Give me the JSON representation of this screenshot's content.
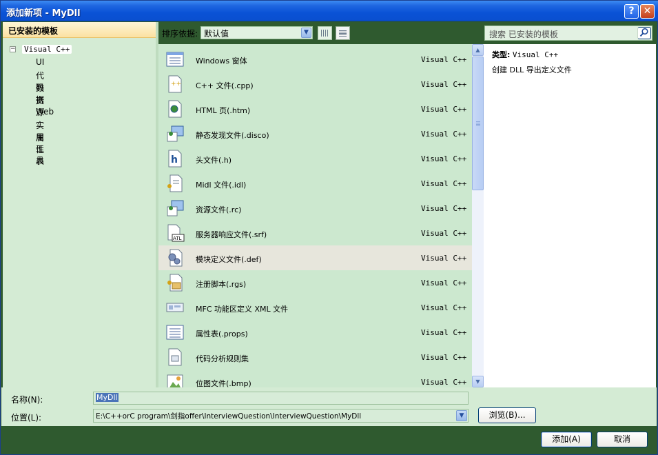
{
  "window": {
    "title": "添加新项 - MyDll",
    "help_label": "?",
    "close_label": "✕"
  },
  "sidebar": {
    "header": "已安装的模板",
    "tree": {
      "root": "Visual C++",
      "toggle": "−",
      "children": [
        "UI",
        "代码",
        "数据",
        "资源",
        "Web",
        "实用工具",
        "属性表"
      ]
    }
  },
  "toolbar": {
    "sort_label": "排序依据:",
    "sort_value": "默认值",
    "search_placeholder": "搜索 已安装的模板"
  },
  "templates": [
    {
      "name": "Windows 窗体",
      "type": "Visual C++",
      "icon": "form-icon"
    },
    {
      "name": "C++ 文件(.cpp)",
      "type": "Visual C++",
      "icon": "cpp-file-icon"
    },
    {
      "name": "HTML 页(.htm)",
      "type": "Visual C++",
      "icon": "html-file-icon"
    },
    {
      "name": "静态发现文件(.disco)",
      "type": "Visual C++",
      "icon": "disco-file-icon"
    },
    {
      "name": "头文件(.h)",
      "type": "Visual C++",
      "icon": "header-file-icon"
    },
    {
      "name": "Midl 文件(.idl)",
      "type": "Visual C++",
      "icon": "idl-file-icon"
    },
    {
      "name": "资源文件(.rc)",
      "type": "Visual C++",
      "icon": "resource-file-icon"
    },
    {
      "name": "服务器响应文件(.srf)",
      "type": "Visual C++",
      "icon": "atl-file-icon"
    },
    {
      "name": "模块定义文件(.def)",
      "type": "Visual C++",
      "icon": "def-file-icon",
      "selected": true
    },
    {
      "name": "注册脚本(.rgs)",
      "type": "Visual C++",
      "icon": "rgs-file-icon"
    },
    {
      "name": "MFC 功能区定义 XML 文件",
      "type": "Visual C++",
      "icon": "ribbon-icon"
    },
    {
      "name": "属性表(.props)",
      "type": "Visual C++",
      "icon": "props-file-icon"
    },
    {
      "name": "代码分析规则集",
      "type": "Visual C++",
      "icon": "ruleset-icon"
    },
    {
      "name": "位图文件(.bmp)",
      "type": "Visual C++",
      "icon": "bitmap-file-icon"
    }
  ],
  "details": {
    "type_label": "类型:",
    "type_value": "Visual C++",
    "description": "创建 DLL 导出定义文件"
  },
  "form": {
    "name_label": "名称(N):",
    "name_value": "MyDll",
    "location_label": "位置(L):",
    "location_value": "E:\\C++orC program\\剑指offer\\InterviewQuestion\\InterviewQuestion\\MyDll",
    "browse_label": "浏览(B)...",
    "add_label": "添加(A)",
    "cancel_label": "取消"
  },
  "colors": {
    "title_bar": "#0a52d6",
    "panel_green": "#cce8cf",
    "selected_row": "#e7e6dc",
    "header_gold": "#fbe1a2"
  }
}
